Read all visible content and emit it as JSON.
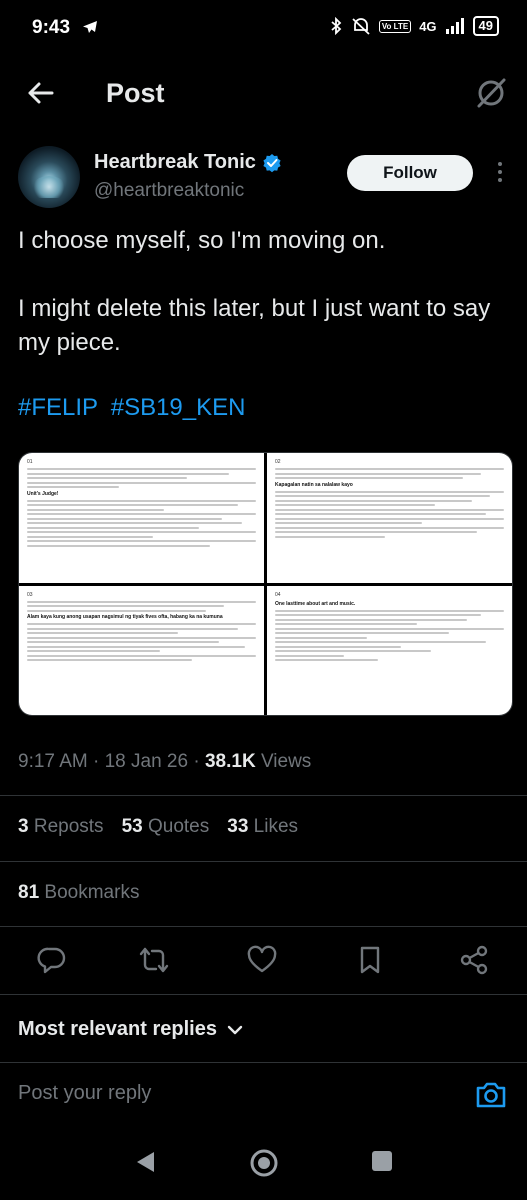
{
  "status_bar": {
    "time": "9:43",
    "network": "4G",
    "volte": "Vo LTE",
    "battery": "49"
  },
  "header": {
    "title": "Post"
  },
  "author": {
    "name": "Heartbreak Tonic",
    "handle": "@heartbreaktonic",
    "follow_label": "Follow",
    "verified_color": "#1d9bf0"
  },
  "post": {
    "line1": "I choose myself, so I'm moving on.",
    "line2": "I might delete this later, but I just want to say my piece.",
    "hashtags": [
      "#FELIP",
      "#SB19_KEN"
    ]
  },
  "media": {
    "pages": [
      "01",
      "02",
      "03",
      "04"
    ],
    "page_headings": [
      "Unit's Judge!",
      "Kapagalan natin sa nalalaw kayo",
      "Alam kaya kung anong usapan nagsimul ng tiyak fives ofta, habang ka na kumuna",
      "One lasttime about art and music."
    ]
  },
  "meta": {
    "time": "9:17 AM",
    "separator": "·",
    "date": "18 Jan 26",
    "views_count": "38.1K",
    "views_label": "Views"
  },
  "stats": {
    "reposts_count": "3",
    "reposts_label": "Reposts",
    "quotes_count": "53",
    "quotes_label": "Quotes",
    "likes_count": "33",
    "likes_label": "Likes",
    "bookmarks_count": "81",
    "bookmarks_label": "Bookmarks"
  },
  "actions": [
    "reply-icon",
    "repost-icon",
    "like-icon",
    "bookmark-icon",
    "share-icon"
  ],
  "replies": {
    "sort_label": "Most relevant replies",
    "placeholder": "Post your reply"
  },
  "colors": {
    "accent": "#1d9bf0",
    "background": "#000000",
    "muted": "#71767b",
    "text": "#e7e9ea"
  }
}
